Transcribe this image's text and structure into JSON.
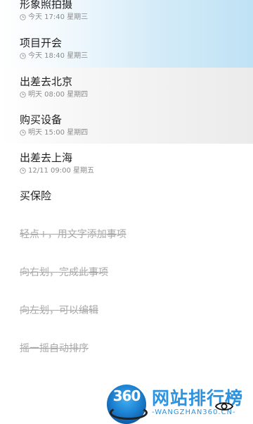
{
  "colors": {
    "title_text": "#222222",
    "meta_text": "#8a8a8a",
    "hint_text": "#a8a8a8",
    "highlight_blue": "#bfe2f5",
    "highlight_gray": "#ebebeb",
    "watermark_blue": "#2b93e0"
  },
  "todos": [
    {
      "title": "形象照拍摄",
      "meta": "今天 17:40 星期三",
      "icon": "clock-icon"
    },
    {
      "title": "项目开会",
      "meta": "今天 18:40 星期三",
      "icon": "clock-icon"
    },
    {
      "title": "出差去北京",
      "meta": "明天 08:00 星期四",
      "icon": "clock-icon"
    },
    {
      "title": "购买设备",
      "meta": "明天 15:00 星期四",
      "icon": "clock-icon"
    },
    {
      "title": "出差去上海",
      "meta": "12/11 09:00 星期五",
      "icon": "clock-icon"
    },
    {
      "title": "买保险"
    }
  ],
  "hints": [
    "轻点+，用文字添加事项",
    "向右划，完成此事项",
    "向左划，可以编辑",
    "摇一摇自动排序"
  ],
  "watermark": {
    "number": "360",
    "cn_text": "网站排行榜",
    "en_text": "-WANGZHAN360.CN-"
  },
  "icons": {
    "eye": "eye-icon"
  }
}
